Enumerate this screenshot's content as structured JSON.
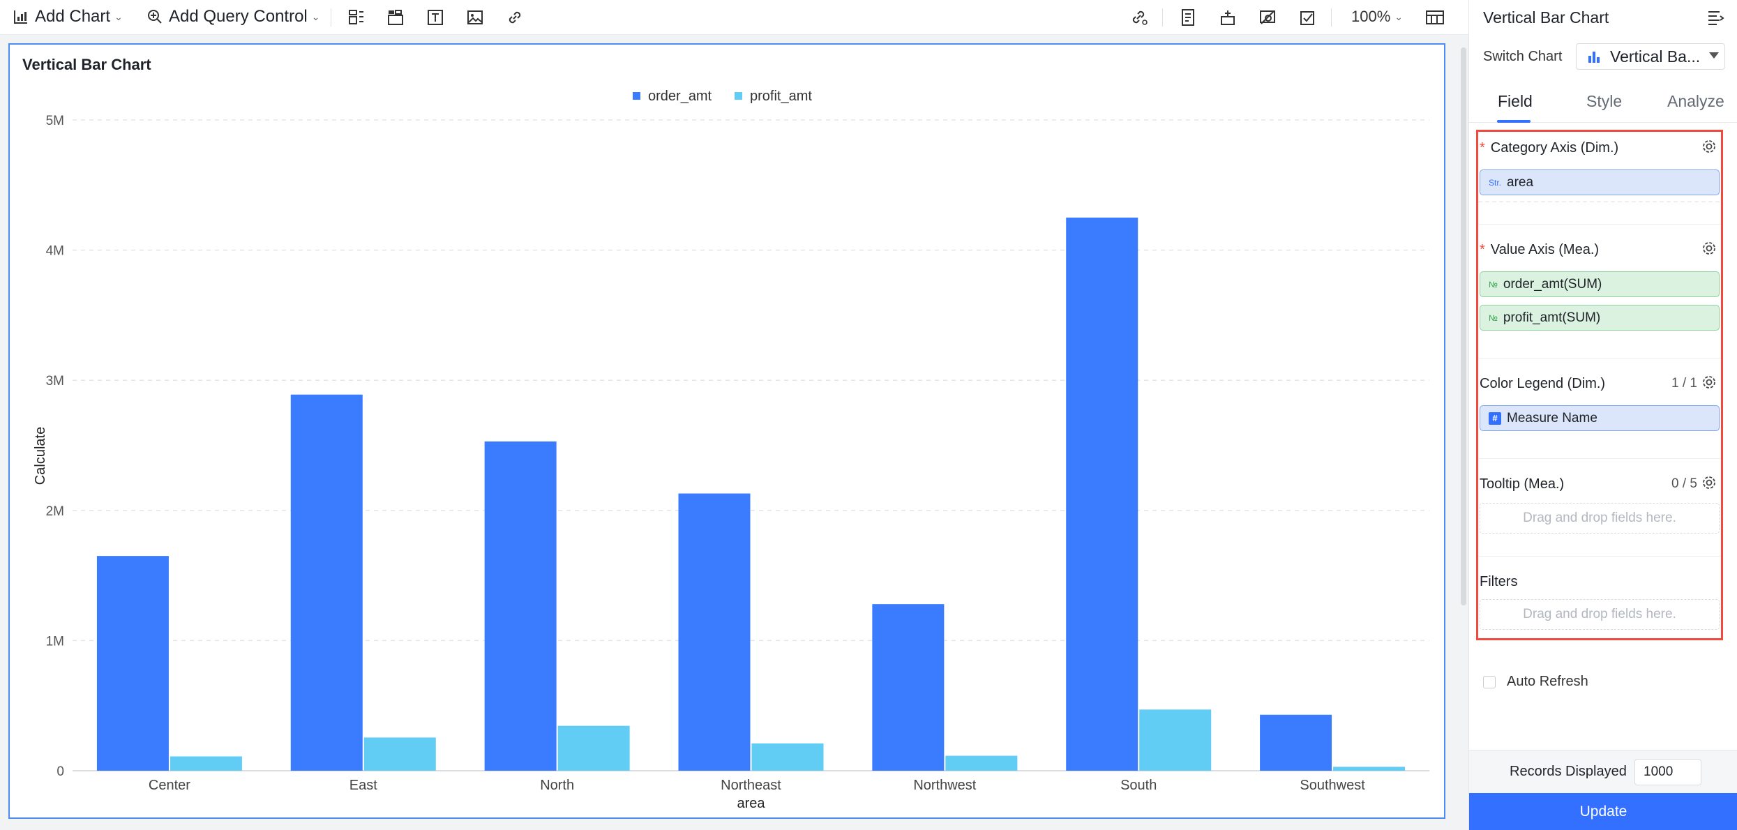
{
  "toolbar": {
    "add_chart": "Add Chart",
    "add_query_control": "Add Query Control",
    "zoom": "100%"
  },
  "chart_data": {
    "type": "bar",
    "title": "Vertical Bar Chart",
    "xlabel": "area",
    "ylabel": "Calculate",
    "categories": [
      "Center",
      "East",
      "North",
      "Northeast",
      "Northwest",
      "South",
      "Southwest"
    ],
    "series": [
      {
        "name": "order_amt",
        "color": "#3b7cff",
        "values": [
          1650000,
          2890000,
          2530000,
          2130000,
          1280000,
          4250000,
          430000
        ]
      },
      {
        "name": "profit_amt",
        "color": "#62cdf4",
        "values": [
          110000,
          255000,
          345000,
          210000,
          115000,
          470000,
          30000
        ]
      }
    ],
    "ylim": [
      0,
      5000000
    ],
    "yticks": [
      "0",
      "1M",
      "2M",
      "3M",
      "4M",
      "5M"
    ],
    "grid": true,
    "legend_position": "top-center"
  },
  "panel": {
    "title": "Vertical Bar Chart",
    "switch_chart_label": "Switch Chart",
    "switch_chart_value": "Vertical Ba...",
    "tabs": [
      "Field",
      "Style",
      "Analyze"
    ],
    "active_tab": "Field",
    "category_axis": {
      "title": "Category Axis (Dim.)",
      "chip_type": "Str.",
      "chip_label": "area"
    },
    "value_axis": {
      "title": "Value Axis (Mea.)",
      "chips": [
        {
          "type": "№",
          "label": "order_amt(SUM)"
        },
        {
          "type": "№",
          "label": "profit_amt(SUM)"
        }
      ]
    },
    "color_legend": {
      "title": "Color Legend (Dim.)",
      "count": "1 / 1",
      "chip_label": "Measure Name"
    },
    "tooltip": {
      "title": "Tooltip (Mea.)",
      "count": "0 / 5",
      "placeholder": "Drag and drop fields here."
    },
    "filters": {
      "title": "Filters",
      "placeholder": "Drag and drop fields here."
    },
    "auto_refresh_label": "Auto Refresh",
    "records_displayed_label": "Records Displayed",
    "records_displayed_value": "1000",
    "update_label": "Update"
  },
  "colors": {
    "accent": "#3370ff",
    "highlight_border": "#f04a3e",
    "selection_border": "#4d8cf5"
  }
}
